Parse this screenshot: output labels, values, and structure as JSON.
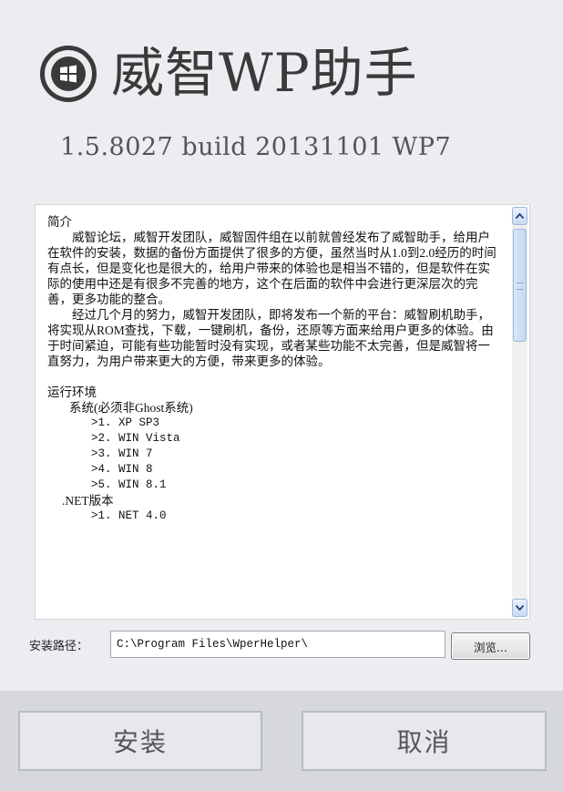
{
  "header": {
    "logo_icon": "windows-phone-logo-icon",
    "title": "威智WP助手",
    "version": "1.5.8027 build 20131101 WP7"
  },
  "readme": {
    "lines": [
      {
        "text": "简介",
        "style": "p"
      },
      {
        "text": "威智论坛，威智开发团队，威智固件组在以前就曾经发布了威智助手，给用户在软件的安装，数据的备份方面提供了很多的方便，虽然当时从1.0到2.0经历的时间有点长，但是变化也是很大的，给用户带来的体验也是相当不错的，但是软件在实际的使用中还是有很多不完善的地方，这个在后面的软件中会进行更深层次的完善，更多功能的整合。",
        "style": "p ind"
      },
      {
        "text": "经过几个月的努力，威智开发团队，即将发布一个新的平台：威智刷机助手，将实现从ROM查找，下载，一键刷机，备份，还原等方面来给用户更多的体验。由于时间紧迫，可能有些功能暂时没有实现，或者某些功能不太完善，但是威智将一直努力，为用户带来更大的方便，带来更多的体验。",
        "style": "p ind"
      },
      {
        "text": "",
        "style": "blank"
      },
      {
        "text": "运行环境",
        "style": "p"
      },
      {
        "text": "系统(必须非Ghost系统)",
        "style": "p",
        "indent": 24
      },
      {
        "text": ">1. XP SP3",
        "style": "p mono",
        "indent": 48
      },
      {
        "text": ">2. WIN Vista",
        "style": "p mono",
        "indent": 48
      },
      {
        "text": ">3. WIN 7",
        "style": "p mono",
        "indent": 48
      },
      {
        "text": ">4. WIN 8",
        "style": "p mono",
        "indent": 48
      },
      {
        "text": ">5. WIN 8.1",
        "style": "p mono",
        "indent": 48
      },
      {
        "text": ".NET版本",
        "style": "p",
        "indent": 16
      },
      {
        "text": ">1. NET 4.0",
        "style": "p mono",
        "indent": 48
      }
    ]
  },
  "install_path": {
    "label": "安装路径：",
    "value": "C:\\Program Files\\WperHelper\\",
    "browse_label": "浏览..."
  },
  "footer": {
    "install_label": "安装",
    "cancel_label": "取消"
  }
}
